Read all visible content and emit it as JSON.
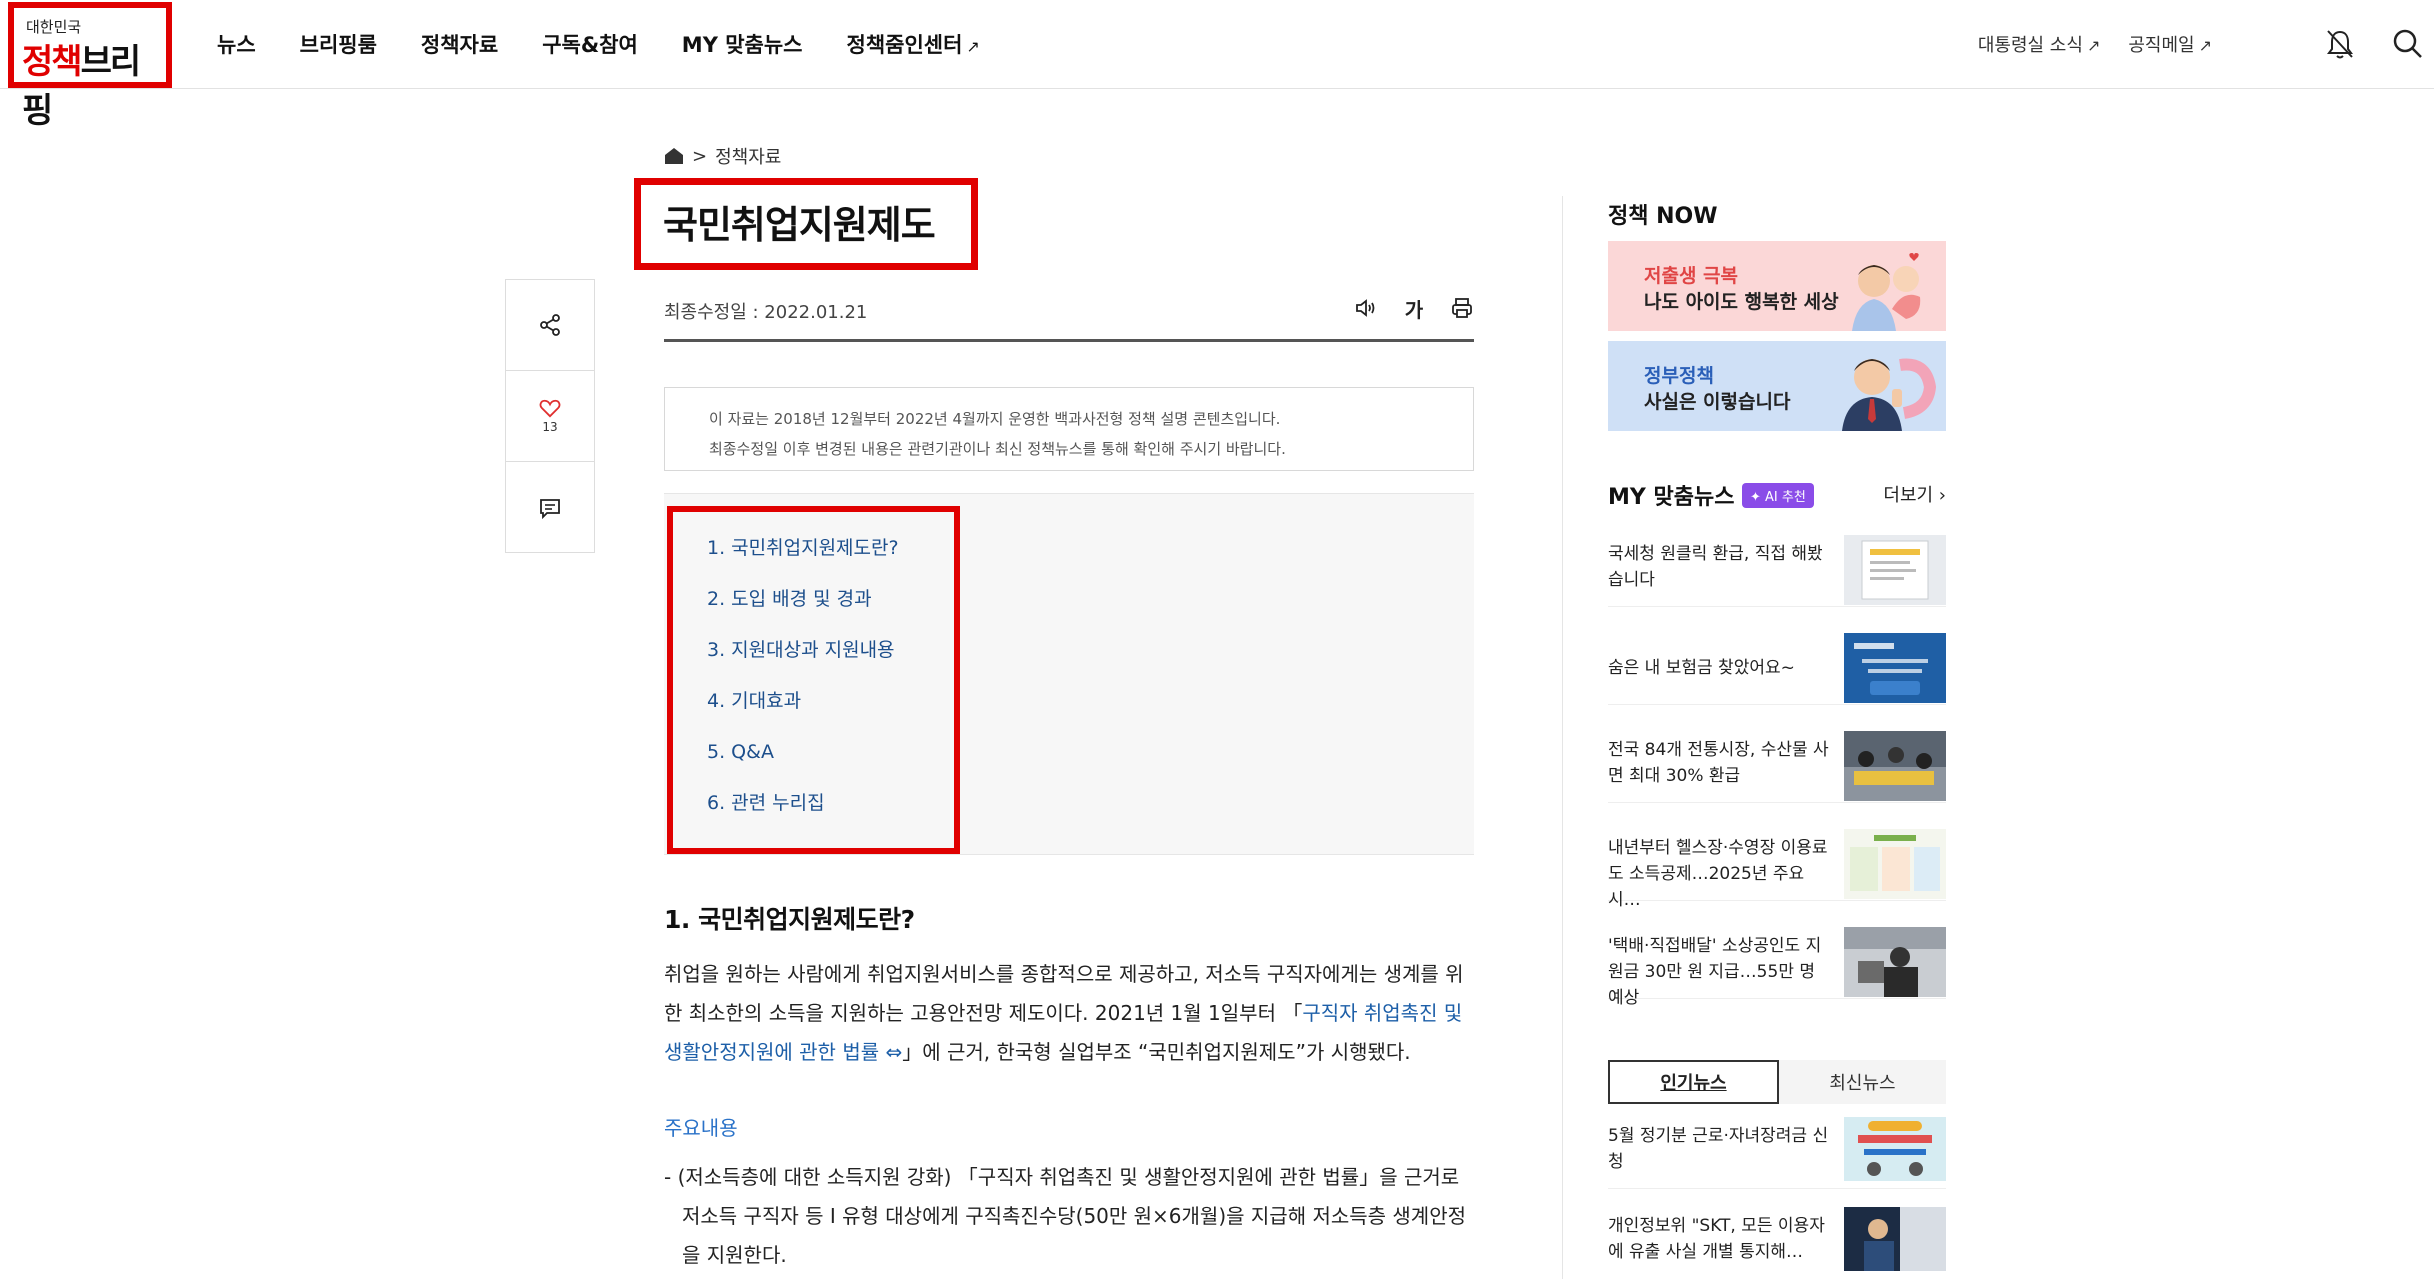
{
  "header": {
    "logo_small": "대한민국",
    "logo_big_part1": "정책",
    "logo_big_part2": "브리핑",
    "nav": [
      "뉴스",
      "브리핑룸",
      "정책자료",
      "구독&참여",
      "MY 맞춤뉴스",
      "정책줌인센터"
    ],
    "util": [
      "대통령실 소식",
      "공직메일"
    ],
    "out_arrow": "↗"
  },
  "breadcrumb": {
    "current": "정책자료",
    "separator": ">"
  },
  "article": {
    "title": "국민취업지원제도",
    "date": "최종수정일 : 2022.01.21",
    "font_tool": "가",
    "notice": [
      "이 자료는 2018년 12월부터 2022년 4월까지 운영한 백과사전형 정책 설명 콘텐츠입니다.",
      "최종수정일 이후 변경된 내용은 관련기관이나 최신 정책뉴스를 통해 확인해 주시기 바랍니다."
    ],
    "toc": [
      "1.  국민취업지원제도란?",
      "2.  도입 배경 및 경과",
      "3.  지원대상과 지원내용",
      "4.  기대효과",
      "5.  Q&A",
      "6.  관련 누리집"
    ],
    "section_title": "1. 국민취업지원제도란?",
    "body_part1": "취업을 원하는 사람에게 취업지원서비스를 종합적으로 제공하고, 저소득 구직자에게는 생계를 위한 최소한의 소득을 지원하는 고용안전망 제도이다. 2021년 1월 1일부터 「",
    "body_link": "구직자 취업촉진 및 생활안정지원에 관한 법률 ⇔",
    "body_part2": "」에 근거, 한국형 실업부조 “국민취업지원제도”가 시행됐다.",
    "sub_heading": "주요내용",
    "bullet": "- (저소득층에 대한 소득지원 강화) 「구직자 취업촉진 및 생활안정지원에 관한 법률」을 근거로 저소득 구직자 등 I 유형 대상에게 구직촉진수당(50만 원×6개월)을 지급해 저소득층 생계안정을 지원한다."
  },
  "side_float": {
    "like_count": "13"
  },
  "right": {
    "policy_now_title": "정책 NOW",
    "banners": [
      {
        "line1": "저출생 극복",
        "line2": "나도 아이도 행복한 세상"
      },
      {
        "line1": "정부정책",
        "line2": "사실은 이렇습니다"
      }
    ],
    "my_news_title": "MY 맞춤뉴스",
    "ai_badge": "✦ AI 추천",
    "more": "더보기 ›",
    "my_news": [
      "국세청 원클릭 환급, 직접 해봤습니다",
      "숨은 내 보험금 찾았어요~",
      "전국 84개 전통시장, 수산물 사면 최대 30% 환급",
      "내년부터 헬스장·수영장 이용료도 소득공제…2025년 주요 시…",
      "'택배·직접배달' 소상공인도 지원금 30만 원 지급…55만 명 예상"
    ],
    "tabs": [
      "인기뉴스",
      "최신뉴스"
    ],
    "popular": [
      "5월 정기분 근로·자녀장려금 신청",
      "개인정보위 \"SKT, 모든 이용자에 유출 사실 개별 통지해…"
    ]
  },
  "colors": {
    "highlight": "#e00000",
    "link": "#1d4f8c",
    "accent": "#8a4ce8"
  }
}
